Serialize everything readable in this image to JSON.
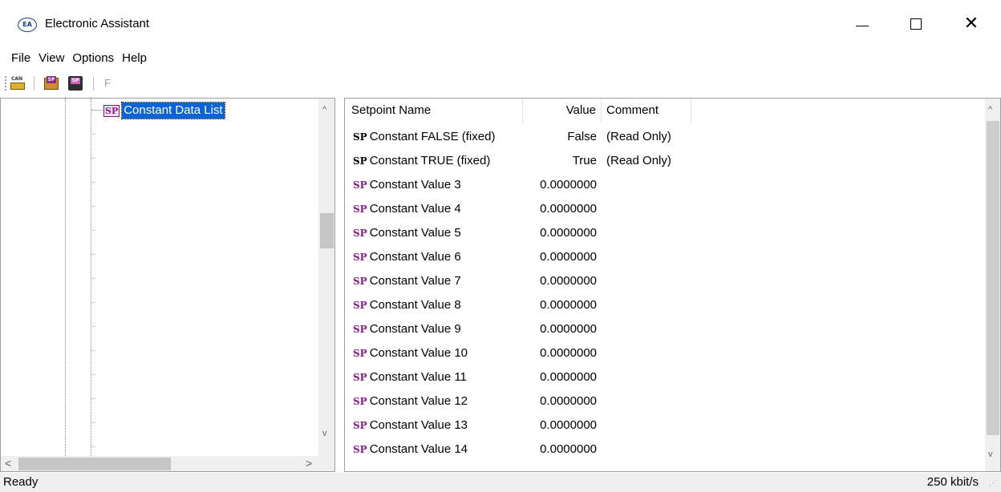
{
  "window": {
    "title": "Electronic Assistant",
    "app_icon_text": "EA",
    "controls": {
      "minimize_icon": "minimize-icon",
      "maximize_icon": "maximize-icon",
      "close_glyph": "✕"
    }
  },
  "menu": {
    "items": [
      "File",
      "View",
      "Options",
      "Help"
    ]
  },
  "toolbar": {
    "buttons": [
      {
        "icon": "can-device-icon",
        "text": "CAN"
      },
      {
        "icon": "open-setpoint-icon",
        "text": "SP"
      },
      {
        "icon": "save-setpoint-icon",
        "text": "SP"
      }
    ],
    "f_label": "F"
  },
  "tree": {
    "selected_node": {
      "badge": "SP",
      "label": "Constant Data List"
    },
    "scroll_up": "^",
    "scroll_down": "v",
    "scroll_left": "<",
    "scroll_right": ">"
  },
  "list": {
    "columns": [
      "Setpoint Name",
      "Value",
      "Comment"
    ],
    "rows": [
      {
        "badge": "SP",
        "name": "Constant FALSE (fixed)",
        "value": "False",
        "comment": "(Read Only)"
      },
      {
        "badge": "SP",
        "name": "Constant TRUE (fixed)",
        "value": "True",
        "comment": "(Read Only)"
      },
      {
        "badge": "SP",
        "name": "Constant Value 3",
        "value": "0.0000000",
        "comment": ""
      },
      {
        "badge": "SP",
        "name": "Constant Value 4",
        "value": "0.0000000",
        "comment": ""
      },
      {
        "badge": "SP",
        "name": "Constant Value 5",
        "value": "0.0000000",
        "comment": ""
      },
      {
        "badge": "SP",
        "name": "Constant Value 6",
        "value": "0.0000000",
        "comment": ""
      },
      {
        "badge": "SP",
        "name": "Constant Value 7",
        "value": "0.0000000",
        "comment": ""
      },
      {
        "badge": "SP",
        "name": "Constant Value 8",
        "value": "0.0000000",
        "comment": ""
      },
      {
        "badge": "SP",
        "name": "Constant Value 9",
        "value": "0.0000000",
        "comment": ""
      },
      {
        "badge": "SP",
        "name": "Constant Value 10",
        "value": "0.0000000",
        "comment": ""
      },
      {
        "badge": "SP",
        "name": "Constant Value 11",
        "value": "0.0000000",
        "comment": ""
      },
      {
        "badge": "SP",
        "name": "Constant Value 12",
        "value": "0.0000000",
        "comment": ""
      },
      {
        "badge": "SP",
        "name": "Constant Value 13",
        "value": "0.0000000",
        "comment": ""
      },
      {
        "badge": "SP",
        "name": "Constant Value 14",
        "value": "0.0000000",
        "comment": ""
      }
    ],
    "scroll_up": "^",
    "scroll_down": "v"
  },
  "status": {
    "left": "Ready",
    "right": "250 kbit/s"
  },
  "colors": {
    "selection": "#0a64d6",
    "sp_badge": "#8b1d8b"
  }
}
